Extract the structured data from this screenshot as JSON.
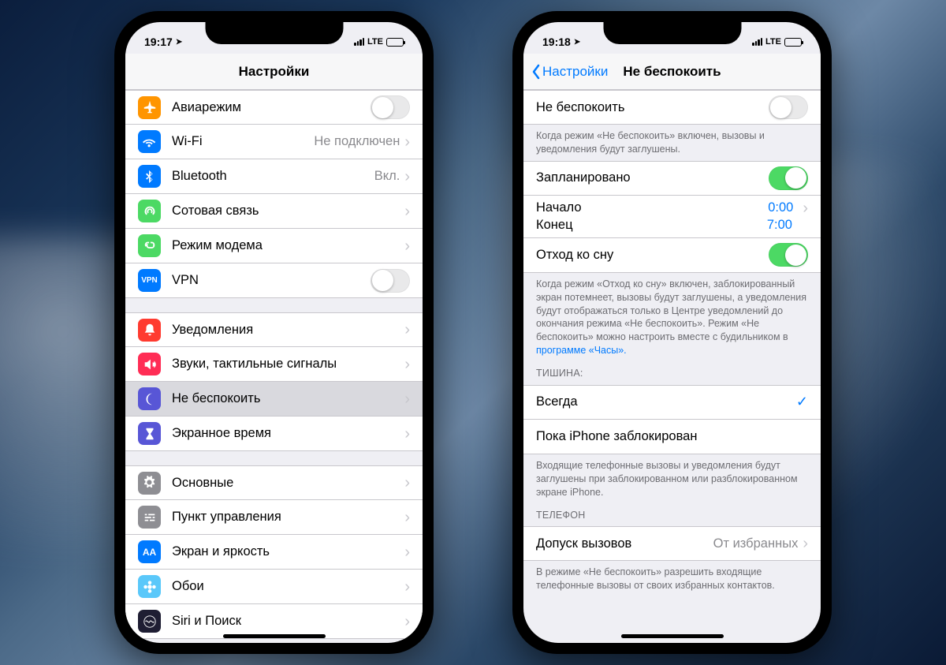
{
  "phoneLeft": {
    "status": {
      "time": "19:17",
      "signal": "LTE"
    },
    "navTitle": "Настройки",
    "groups": [
      {
        "rows": [
          {
            "icon": "airplane",
            "color": "#ff9500",
            "label": "Авиарежим",
            "type": "toggle",
            "on": false
          },
          {
            "icon": "wifi",
            "color": "#007aff",
            "label": "Wi-Fi",
            "value": "Не подключен",
            "type": "link"
          },
          {
            "icon": "bluetooth",
            "color": "#007aff",
            "label": "Bluetooth",
            "value": "Вкл.",
            "type": "link"
          },
          {
            "icon": "antenna",
            "color": "#4cd964",
            "label": "Сотовая связь",
            "type": "link"
          },
          {
            "icon": "hotspot",
            "color": "#4cd964",
            "label": "Режим модема",
            "type": "link"
          },
          {
            "icon": "vpn",
            "color": "#007aff",
            "label": "VPN",
            "type": "toggle",
            "on": false
          }
        ]
      },
      {
        "rows": [
          {
            "icon": "notify",
            "color": "#ff3b30",
            "label": "Уведомления",
            "type": "link"
          },
          {
            "icon": "sound",
            "color": "#ff2d55",
            "label": "Звуки, тактильные сигналы",
            "type": "link"
          },
          {
            "icon": "moon",
            "color": "#5856d6",
            "label": "Не беспокоить",
            "type": "link",
            "selected": true
          },
          {
            "icon": "hourglass",
            "color": "#5856d6",
            "label": "Экранное время",
            "type": "link"
          }
        ]
      },
      {
        "rows": [
          {
            "icon": "gear",
            "color": "#8e8e93",
            "label": "Основные",
            "type": "link"
          },
          {
            "icon": "sliders",
            "color": "#8e8e93",
            "label": "Пункт управления",
            "type": "link"
          },
          {
            "icon": "display",
            "color": "#007aff",
            "label": "Экран и яркость",
            "type": "link"
          },
          {
            "icon": "flower",
            "color": "#5ac8fa",
            "label": "Обои",
            "type": "link"
          },
          {
            "icon": "siri",
            "color": "#1f1e33",
            "label": "Siri и Поиск",
            "type": "link"
          }
        ]
      }
    ]
  },
  "phoneRight": {
    "status": {
      "time": "19:18",
      "signal": "LTE"
    },
    "navBack": "Настройки",
    "navTitle": "Не беспокоить",
    "sections": {
      "dnd": {
        "label": "Не беспокоить",
        "on": false,
        "footer": "Когда режим «Не беспокоить» включен, вызовы и уведомления будут заглушены."
      },
      "scheduled": {
        "label": "Запланировано",
        "on": true
      },
      "start": {
        "label": "Начало",
        "value": "0:00"
      },
      "end": {
        "label": "Конец",
        "value": "7:00"
      },
      "sleep": {
        "label": "Отход ко сну",
        "on": true,
        "footer": "Когда режим «Отход ко сну» включен, заблокированный экран потемнеет, вызовы будут заглушены, а уведомления будут отображаться только в Центре уведомлений до окончания режима «Не беспокоить». Режим «Не беспокоить» можно настроить вместе с будильником в ",
        "footerLink": "программе «Часы»."
      },
      "silenceHeader": "ТИШИНА:",
      "always": {
        "label": "Всегда",
        "checked": true
      },
      "locked": {
        "label": "Пока iPhone заблокирован"
      },
      "silenceFooter": "Входящие телефонные вызовы и уведомления будут заглушены при заблокированном или разблокированном экране iPhone.",
      "phoneHeader": "ТЕЛЕФОН",
      "allow": {
        "label": "Допуск вызовов",
        "value": "От избранных"
      },
      "allowFooter": "В режиме «Не беспокоить» разрешить входящие телефонные вызовы от своих избранных контактов."
    }
  }
}
